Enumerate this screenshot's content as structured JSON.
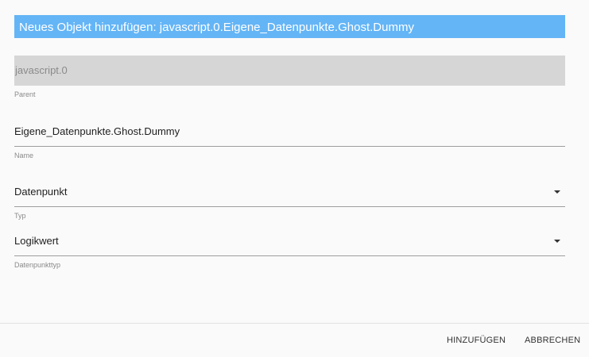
{
  "dialog": {
    "title": "Neues Objekt hinzufügen: javascript.0.Eigene_Datenpunkte.Ghost.Dummy"
  },
  "fields": {
    "parent": {
      "value": "javascript.0",
      "label": "Parent"
    },
    "name": {
      "value": "Eigene_Datenpunkte.Ghost.Dummy",
      "label": "Name"
    },
    "type": {
      "value": "Datenpunkt",
      "label": "Typ"
    },
    "datapoint_type": {
      "value": "Logikwert",
      "label": "Datenpunkttyp"
    }
  },
  "buttons": {
    "add": "HINZUFÜGEN",
    "cancel": "ABBRECHEN"
  },
  "colors": {
    "title_bar": "#64b5f6",
    "disabled_field": "#d6d6d6"
  },
  "icons": {
    "select_caret": "caret-down-icon"
  }
}
